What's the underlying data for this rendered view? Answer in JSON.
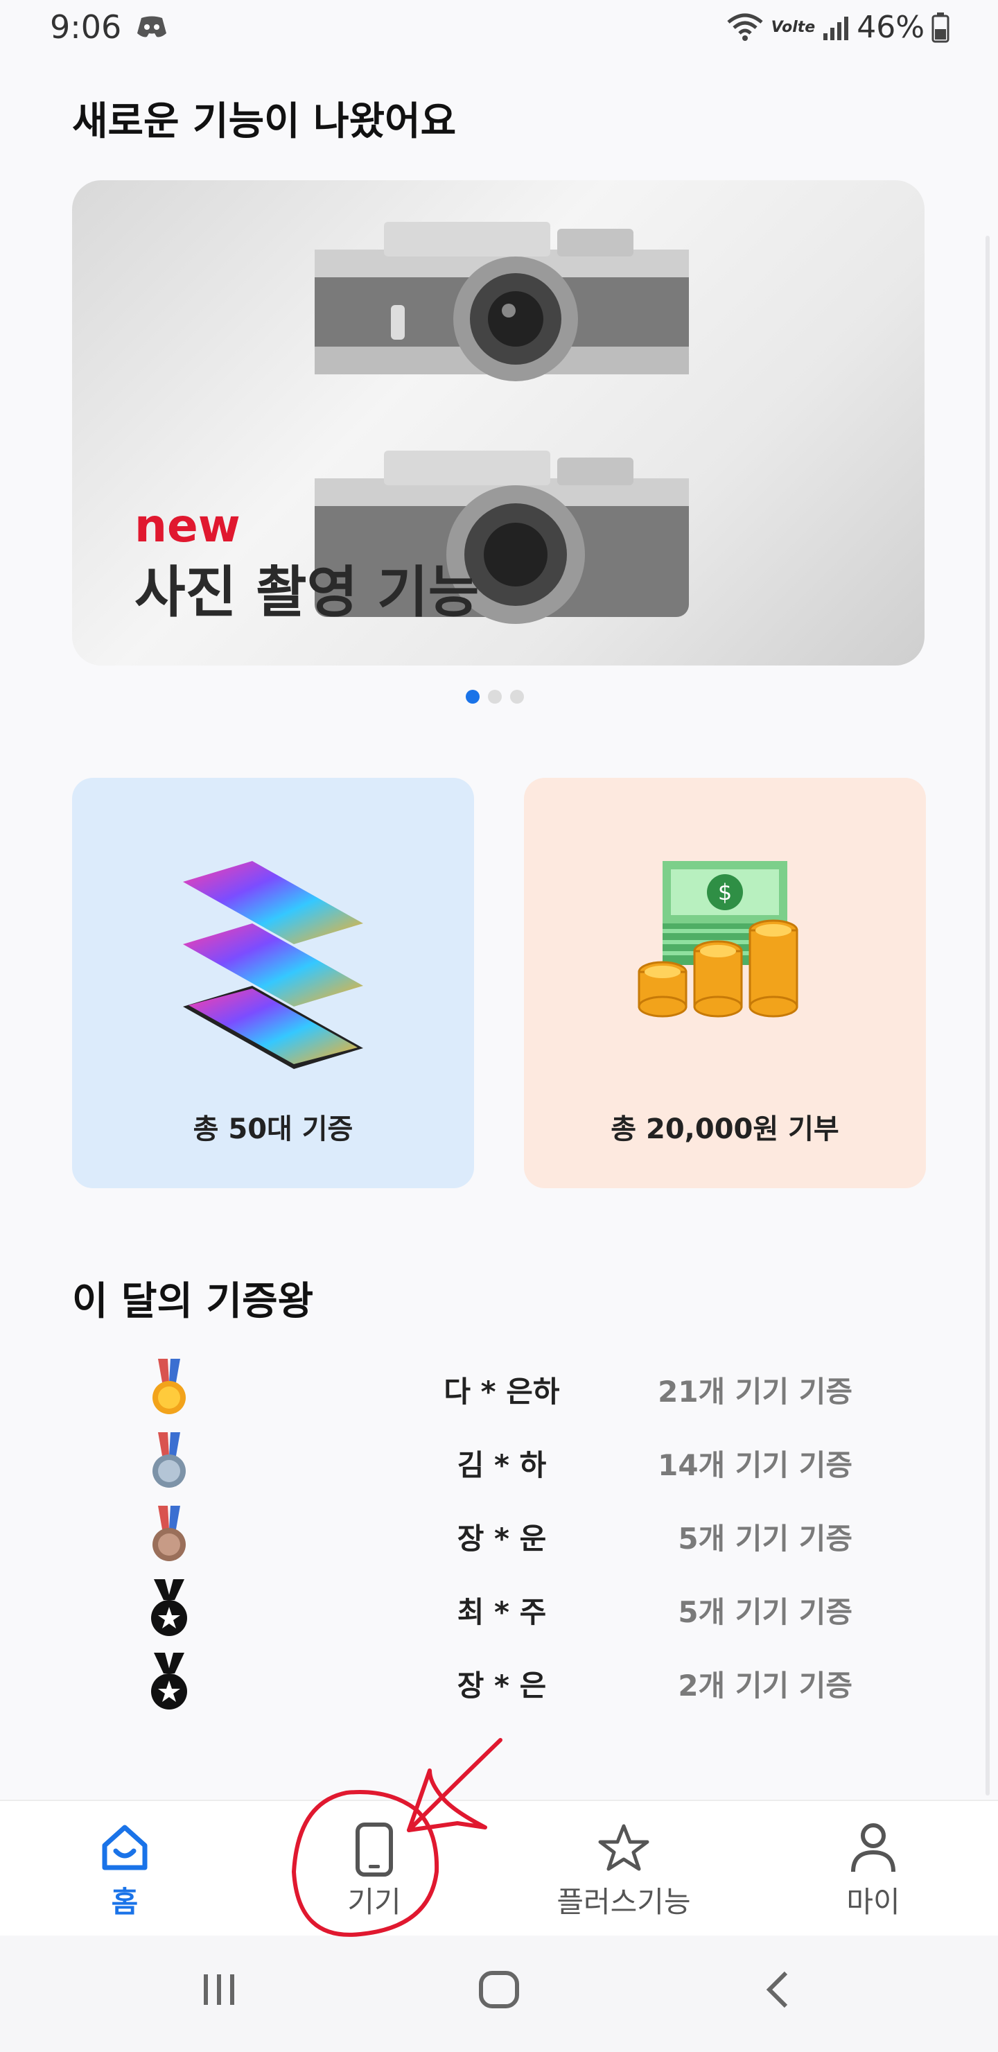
{
  "status_bar": {
    "time": "9:06",
    "network": "Volte",
    "battery": "46%"
  },
  "new_features": {
    "title": "새로운 기능이 나왔어요",
    "banner_tag": "new",
    "banner_title": "사진 촬영 기능",
    "carousel_total": 3,
    "carousel_active": 1
  },
  "stats": {
    "devices_label": "총 50대 기증",
    "donation_label": "총 20,000원 기부"
  },
  "ranking": {
    "title": "이 달의 기증왕",
    "rows": [
      {
        "name": "다 * 은하",
        "count": "21개 기기 기증",
        "medal": "gold-medal-icon"
      },
      {
        "name": "김 * 하",
        "count": "14개 기기 기증",
        "medal": "silver-medal-icon"
      },
      {
        "name": "장 * 운",
        "count": "5개 기기 기증",
        "medal": "bronze-medal-icon"
      },
      {
        "name": "최 * 주",
        "count": "5개 기기 기증",
        "medal": "star-medal-icon"
      },
      {
        "name": "장 * 은",
        "count": "2개 기기 기증",
        "medal": "star-medal-icon"
      }
    ]
  },
  "bottom_nav": {
    "items": [
      {
        "label": "홈",
        "icon": "home-icon",
        "active": true
      },
      {
        "label": "기기",
        "icon": "phone-icon",
        "active": false
      },
      {
        "label": "플러스기능",
        "icon": "star-icon",
        "active": false
      },
      {
        "label": "마이",
        "icon": "person-icon",
        "active": false
      }
    ]
  },
  "colors": {
    "accent": "#1a73e8",
    "annotation": "#e0182f",
    "card_blue": "#dcebfb",
    "card_peach": "#fde9df"
  }
}
